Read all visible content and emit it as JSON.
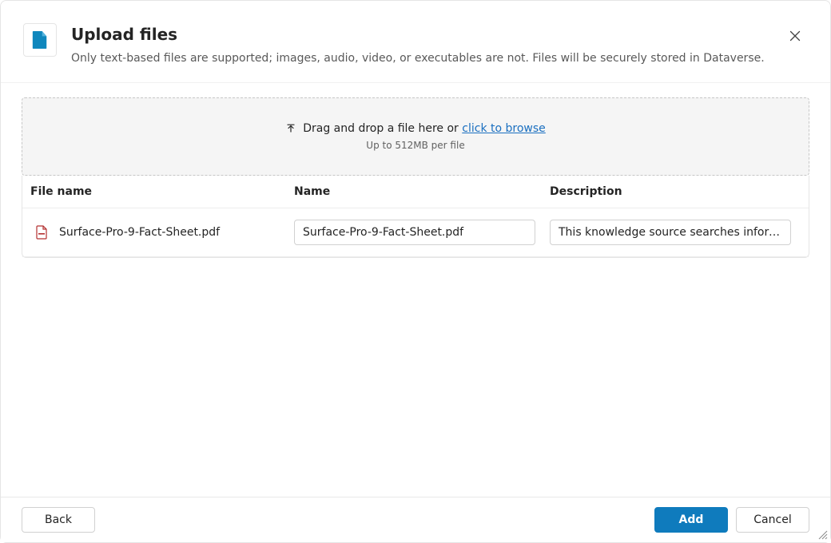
{
  "header": {
    "title": "Upload files",
    "subtitle": "Only text-based files are supported; images, audio, video, or executables are not. Files will be securely stored in Dataverse."
  },
  "dropzone": {
    "prefix": "Drag and drop a file here or ",
    "browse_link": "click to browse",
    "hint": "Up to 512MB per file"
  },
  "columns": {
    "file_name": "File name",
    "name": "Name",
    "description": "Description"
  },
  "files": [
    {
      "file_name": "Surface-Pro-9-Fact-Sheet.pdf",
      "name_value": "Surface-Pro-9-Fact-Sheet.pdf",
      "description_value": "This knowledge source searches information "
    }
  ],
  "footer": {
    "back_label": "Back",
    "add_label": "Add",
    "cancel_label": "Cancel"
  }
}
